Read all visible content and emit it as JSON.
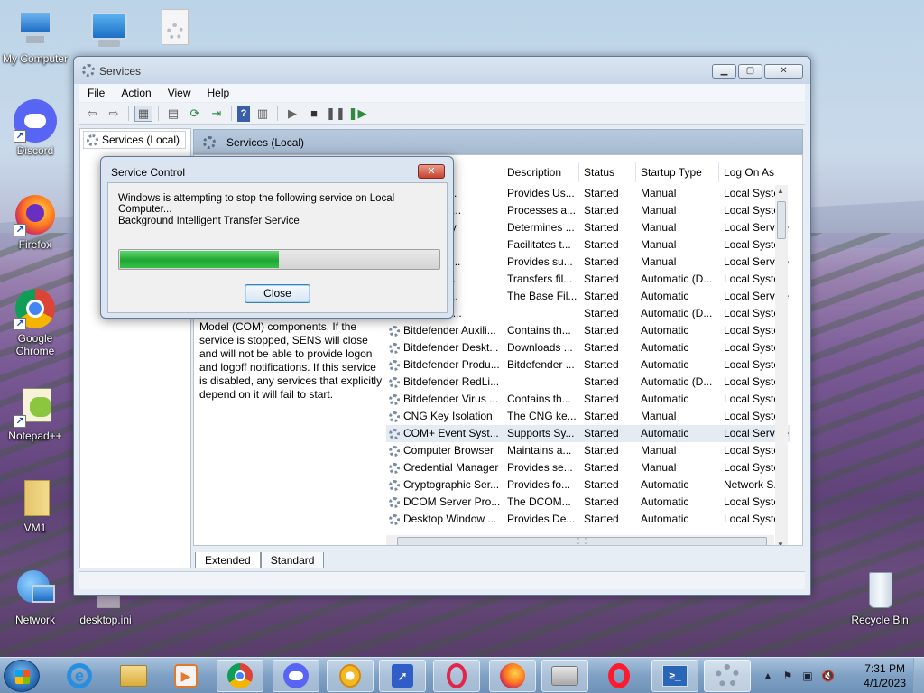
{
  "desktop": {
    "icons": [
      {
        "label": "My Computer"
      },
      {
        "label": ""
      },
      {
        "label": ""
      },
      {
        "label": "Discord"
      },
      {
        "label": "Firefox"
      },
      {
        "label": "Google Chrome"
      },
      {
        "label": "Notepad++"
      },
      {
        "label": "VM1"
      },
      {
        "label": "Network"
      },
      {
        "label": "desktop.ini"
      },
      {
        "label": "Recycle Bin"
      }
    ]
  },
  "window": {
    "title": "Services",
    "menu": [
      "File",
      "Action",
      "View",
      "Help"
    ],
    "tree_node": "Services (Local)",
    "pane_title": "Services (Local)",
    "description_text": "Model (COM) components. If the service is stopped, SENS will close and will not be able to provide logon and logoff notifications. If this service is disabled, any services that explicitly depend on it will fail to start.",
    "columns": [
      "Description",
      "Status",
      "Startup Type",
      "Log On As"
    ],
    "rows": [
      {
        "name": "...staller (...",
        "description": "Provides Us...",
        "status": "Started",
        "startup": "Manual",
        "logon": "Local Syste..."
      },
      {
        "name": "...n Experi...",
        "description": "Processes a...",
        "status": "Started",
        "startup": "Manual",
        "logon": "Local Syste..."
      },
      {
        "name": "...n Identity",
        "description": "Determines ...",
        "status": "Started",
        "startup": "Manual",
        "logon": "Local Service"
      },
      {
        "name": "...n Infor...",
        "description": "Facilitates t...",
        "status": "Started",
        "startup": "Manual",
        "logon": "Local Syste..."
      },
      {
        "name": "...n Layer ...",
        "description": "Provides su...",
        "status": "Started",
        "startup": "Manual",
        "logon": "Local Service"
      },
      {
        "name": "...d Intelli...",
        "description": "Transfers fil...",
        "status": "Started",
        "startup": "Automatic (D...",
        "logon": "Local Syste..."
      },
      {
        "name": "...ng Engi...",
        "description": "The Base Fil...",
        "status": "Started",
        "startup": "Automatic",
        "logon": "Local Service"
      },
      {
        "name": "...er Agent...",
        "description": "",
        "status": "Started",
        "startup": "Automatic (D...",
        "logon": "Local Syste..."
      },
      {
        "name": "Bitdefender Auxili...",
        "description": "Contains th...",
        "status": "Started",
        "startup": "Automatic",
        "logon": "Local Syste..."
      },
      {
        "name": "Bitdefender Deskt...",
        "description": "Downloads ...",
        "status": "Started",
        "startup": "Automatic",
        "logon": "Local Syste..."
      },
      {
        "name": "Bitdefender Produ...",
        "description": "Bitdefender ...",
        "status": "Started",
        "startup": "Automatic",
        "logon": "Local Syste..."
      },
      {
        "name": "Bitdefender RedLi...",
        "description": "",
        "status": "Started",
        "startup": "Automatic (D...",
        "logon": "Local Syste..."
      },
      {
        "name": "Bitdefender Virus ...",
        "description": "Contains th...",
        "status": "Started",
        "startup": "Automatic",
        "logon": "Local Syste..."
      },
      {
        "name": "CNG Key Isolation",
        "description": "The CNG ke...",
        "status": "Started",
        "startup": "Manual",
        "logon": "Local Syste..."
      },
      {
        "name": "COM+ Event Syst...",
        "description": "Supports Sy...",
        "status": "Started",
        "startup": "Automatic",
        "logon": "Local Service"
      },
      {
        "name": "Computer Browser",
        "description": "Maintains a...",
        "status": "Started",
        "startup": "Manual",
        "logon": "Local Syste..."
      },
      {
        "name": "Credential Manager",
        "description": "Provides se...",
        "status": "Started",
        "startup": "Manual",
        "logon": "Local Syste..."
      },
      {
        "name": "Cryptographic Ser...",
        "description": "Provides fo...",
        "status": "Started",
        "startup": "Automatic",
        "logon": "Network S..."
      },
      {
        "name": "DCOM Server Pro...",
        "description": "The DCOM...",
        "status": "Started",
        "startup": "Automatic",
        "logon": "Local Syste..."
      },
      {
        "name": "Desktop Window ...",
        "description": "Provides De...",
        "status": "Started",
        "startup": "Automatic",
        "logon": "Local Syste..."
      }
    ],
    "tabs": [
      "Extended",
      "Standard"
    ]
  },
  "dialog": {
    "title": "Service Control",
    "message": "Windows is attempting to stop the following service on Local Computer...",
    "service": "Background Intelligent Transfer Service",
    "progress": 0.5,
    "close_label": "Close"
  },
  "taskbar": {
    "time": "7:31 PM",
    "date": "4/1/2023"
  },
  "colors": {
    "progress_green": "#1fa631",
    "dialog_close_red": "#c8432c"
  }
}
